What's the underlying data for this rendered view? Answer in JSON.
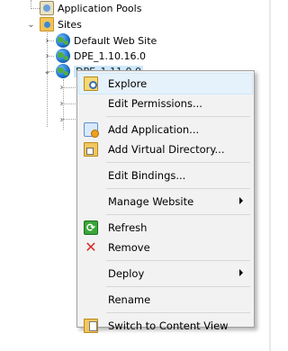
{
  "tree": {
    "app_pools": "Application Pools",
    "sites": "Sites",
    "site_items": [
      {
        "label": "Default Web Site"
      },
      {
        "label": "DPE_1.10.16.0"
      },
      {
        "label": "DPE_1.11.0.0"
      }
    ]
  },
  "context_menu": {
    "items": [
      {
        "label": "Explore",
        "icon": "explore-icon"
      },
      {
        "label": "Edit Permissions..."
      },
      {
        "label": "Add Application...",
        "icon": "add-application-icon"
      },
      {
        "label": "Add Virtual Directory...",
        "icon": "add-virtual-directory-icon"
      },
      {
        "label": "Edit Bindings..."
      },
      {
        "label": "Manage Website",
        "submenu": true
      },
      {
        "label": "Refresh",
        "icon": "refresh-icon"
      },
      {
        "label": "Remove",
        "icon": "remove-icon"
      },
      {
        "label": "Deploy",
        "submenu": true
      },
      {
        "label": "Rename"
      },
      {
        "label": "Switch to Content View",
        "icon": "content-view-icon"
      }
    ]
  },
  "colors": {
    "menu_bg": "#f2f2f2",
    "menu_border": "#a0a0a0",
    "selection": "#cce8ff"
  }
}
